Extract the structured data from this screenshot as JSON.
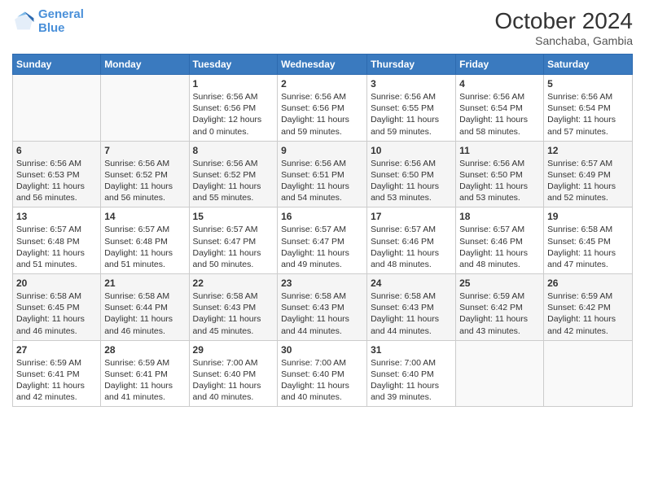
{
  "logo": {
    "line1": "General",
    "line2": "Blue"
  },
  "title": "October 2024",
  "location": "Sanchaba, Gambia",
  "days_header": [
    "Sunday",
    "Monday",
    "Tuesday",
    "Wednesday",
    "Thursday",
    "Friday",
    "Saturday"
  ],
  "weeks": [
    [
      {
        "num": "",
        "info": ""
      },
      {
        "num": "",
        "info": ""
      },
      {
        "num": "1",
        "info": "Sunrise: 6:56 AM\nSunset: 6:56 PM\nDaylight: 12 hours\nand 0 minutes."
      },
      {
        "num": "2",
        "info": "Sunrise: 6:56 AM\nSunset: 6:56 PM\nDaylight: 11 hours\nand 59 minutes."
      },
      {
        "num": "3",
        "info": "Sunrise: 6:56 AM\nSunset: 6:55 PM\nDaylight: 11 hours\nand 59 minutes."
      },
      {
        "num": "4",
        "info": "Sunrise: 6:56 AM\nSunset: 6:54 PM\nDaylight: 11 hours\nand 58 minutes."
      },
      {
        "num": "5",
        "info": "Sunrise: 6:56 AM\nSunset: 6:54 PM\nDaylight: 11 hours\nand 57 minutes."
      }
    ],
    [
      {
        "num": "6",
        "info": "Sunrise: 6:56 AM\nSunset: 6:53 PM\nDaylight: 11 hours\nand 56 minutes."
      },
      {
        "num": "7",
        "info": "Sunrise: 6:56 AM\nSunset: 6:52 PM\nDaylight: 11 hours\nand 56 minutes."
      },
      {
        "num": "8",
        "info": "Sunrise: 6:56 AM\nSunset: 6:52 PM\nDaylight: 11 hours\nand 55 minutes."
      },
      {
        "num": "9",
        "info": "Sunrise: 6:56 AM\nSunset: 6:51 PM\nDaylight: 11 hours\nand 54 minutes."
      },
      {
        "num": "10",
        "info": "Sunrise: 6:56 AM\nSunset: 6:50 PM\nDaylight: 11 hours\nand 53 minutes."
      },
      {
        "num": "11",
        "info": "Sunrise: 6:56 AM\nSunset: 6:50 PM\nDaylight: 11 hours\nand 53 minutes."
      },
      {
        "num": "12",
        "info": "Sunrise: 6:57 AM\nSunset: 6:49 PM\nDaylight: 11 hours\nand 52 minutes."
      }
    ],
    [
      {
        "num": "13",
        "info": "Sunrise: 6:57 AM\nSunset: 6:48 PM\nDaylight: 11 hours\nand 51 minutes."
      },
      {
        "num": "14",
        "info": "Sunrise: 6:57 AM\nSunset: 6:48 PM\nDaylight: 11 hours\nand 51 minutes."
      },
      {
        "num": "15",
        "info": "Sunrise: 6:57 AM\nSunset: 6:47 PM\nDaylight: 11 hours\nand 50 minutes."
      },
      {
        "num": "16",
        "info": "Sunrise: 6:57 AM\nSunset: 6:47 PM\nDaylight: 11 hours\nand 49 minutes."
      },
      {
        "num": "17",
        "info": "Sunrise: 6:57 AM\nSunset: 6:46 PM\nDaylight: 11 hours\nand 48 minutes."
      },
      {
        "num": "18",
        "info": "Sunrise: 6:57 AM\nSunset: 6:46 PM\nDaylight: 11 hours\nand 48 minutes."
      },
      {
        "num": "19",
        "info": "Sunrise: 6:58 AM\nSunset: 6:45 PM\nDaylight: 11 hours\nand 47 minutes."
      }
    ],
    [
      {
        "num": "20",
        "info": "Sunrise: 6:58 AM\nSunset: 6:45 PM\nDaylight: 11 hours\nand 46 minutes."
      },
      {
        "num": "21",
        "info": "Sunrise: 6:58 AM\nSunset: 6:44 PM\nDaylight: 11 hours\nand 46 minutes."
      },
      {
        "num": "22",
        "info": "Sunrise: 6:58 AM\nSunset: 6:43 PM\nDaylight: 11 hours\nand 45 minutes."
      },
      {
        "num": "23",
        "info": "Sunrise: 6:58 AM\nSunset: 6:43 PM\nDaylight: 11 hours\nand 44 minutes."
      },
      {
        "num": "24",
        "info": "Sunrise: 6:58 AM\nSunset: 6:43 PM\nDaylight: 11 hours\nand 44 minutes."
      },
      {
        "num": "25",
        "info": "Sunrise: 6:59 AM\nSunset: 6:42 PM\nDaylight: 11 hours\nand 43 minutes."
      },
      {
        "num": "26",
        "info": "Sunrise: 6:59 AM\nSunset: 6:42 PM\nDaylight: 11 hours\nand 42 minutes."
      }
    ],
    [
      {
        "num": "27",
        "info": "Sunrise: 6:59 AM\nSunset: 6:41 PM\nDaylight: 11 hours\nand 42 minutes."
      },
      {
        "num": "28",
        "info": "Sunrise: 6:59 AM\nSunset: 6:41 PM\nDaylight: 11 hours\nand 41 minutes."
      },
      {
        "num": "29",
        "info": "Sunrise: 7:00 AM\nSunset: 6:40 PM\nDaylight: 11 hours\nand 40 minutes."
      },
      {
        "num": "30",
        "info": "Sunrise: 7:00 AM\nSunset: 6:40 PM\nDaylight: 11 hours\nand 40 minutes."
      },
      {
        "num": "31",
        "info": "Sunrise: 7:00 AM\nSunset: 6:40 PM\nDaylight: 11 hours\nand 39 minutes."
      },
      {
        "num": "",
        "info": ""
      },
      {
        "num": "",
        "info": ""
      }
    ]
  ]
}
